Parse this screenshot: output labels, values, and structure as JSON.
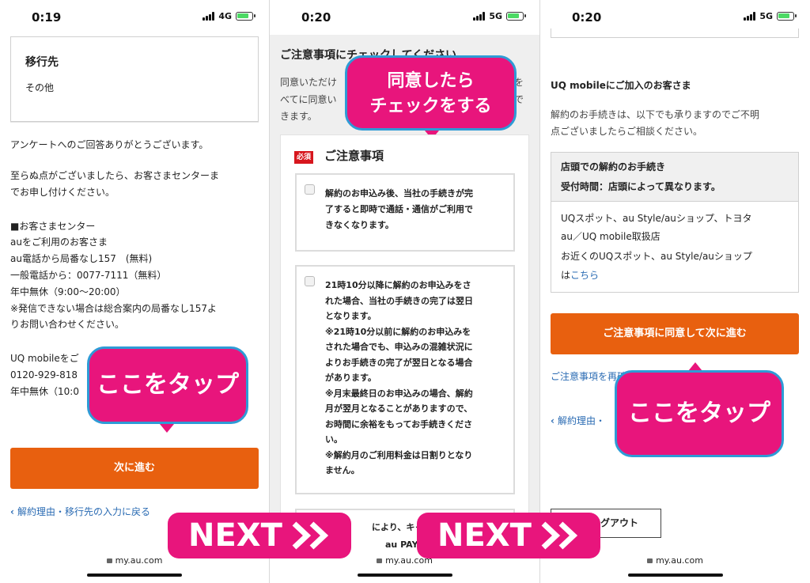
{
  "screen1": {
    "status": {
      "time": "0:19",
      "network": "4G"
    },
    "dest_card": {
      "title": "移行先",
      "value": "その他"
    },
    "lines": [
      "アンケートへのご回答ありがとうございます。",
      "至らぬ点がございましたら、お客さまセンターま",
      "でお申し付けください。",
      "■お客さまセンター",
      "auをご利用のお客さま",
      "au電話から局番なし157　(無料)",
      "一般電話から：0077-7111（無料）",
      "年中無休（9:00〜20:00）",
      "※発信できない場合は総合案内の局番なし157よ",
      "りお問い合わせください。",
      "UQ mobileをご",
      "0120-929-818",
      "年中無休（10:0"
    ],
    "bubble": "ここをタップ",
    "next_button": "次に進む",
    "back_link": "解約理由・移行先の入力に戻る",
    "url": "my.au.com"
  },
  "screen2": {
    "status": {
      "time": "0:20",
      "network": "5G"
    },
    "heading": "ご注意事項にチェックしてください",
    "intro": [
      "同意いただけ",
      "べてに同意い",
      "きます。"
    ],
    "bubble": [
      "同意したら",
      "チェックをする"
    ],
    "required_badge": "必須",
    "notes_title": "ご注意事項",
    "item1": [
      "解約のお申込み後、当社の手続きが完",
      "了すると即時で通話・通信がご利用で",
      "きなくなります。"
    ],
    "item2": [
      "21時10分以降に解約のお申込みをさ",
      "れた場合、当社の手続きの完了は翌日",
      "となります。",
      "※21時10分以前に解約のお申込みを",
      "された場合でも、申込みの混雑状況に",
      "よりお手続きの完了が翌日となる場合",
      "があります。",
      "※月末最終日のお申込みの場合、解約",
      "月が翌月となることがありますので、",
      "お時間に余裕をもってお手続きくださ",
      "い。",
      "※解約月のご利用料金は日割りとなり",
      "ません。"
    ],
    "item3_partial": [
      "により、キャ",
      "au PAY"
    ],
    "url": "my.au.com"
  },
  "screen3": {
    "status": {
      "time": "0:20",
      "network": "5G"
    },
    "heading": "UQ mobileにご加入のお客さま",
    "intro": [
      "解約のお手続きは、以下でも承りますのでご不明",
      "点ございましたらご相談ください。"
    ],
    "box_header": [
      "店頭での解約のお手続き",
      "受付時間：店頭によって異なります。"
    ],
    "box_body": [
      "UQスポット、au Style/auショップ、トヨタ",
      "au／UQ mobile取扱店",
      "お近くのUQスポット、au Style/auショップ",
      "は"
    ],
    "box_link": "こちら",
    "agree_button": "ご注意事項に同意して次に進む",
    "recheck_link": "ご注意事項を再確認す",
    "back_link": "解約理由・",
    "bubble": "ここをタップ",
    "logout_button": "ログアウト",
    "url": "my.au.com"
  },
  "next_label": "NEXT",
  "colors": {
    "accent_pink": "#e8157c",
    "bubble_border": "#2e9bd6",
    "orange": "#e8600f",
    "link": "#2a6bb3",
    "required_red": "#d7161d"
  }
}
